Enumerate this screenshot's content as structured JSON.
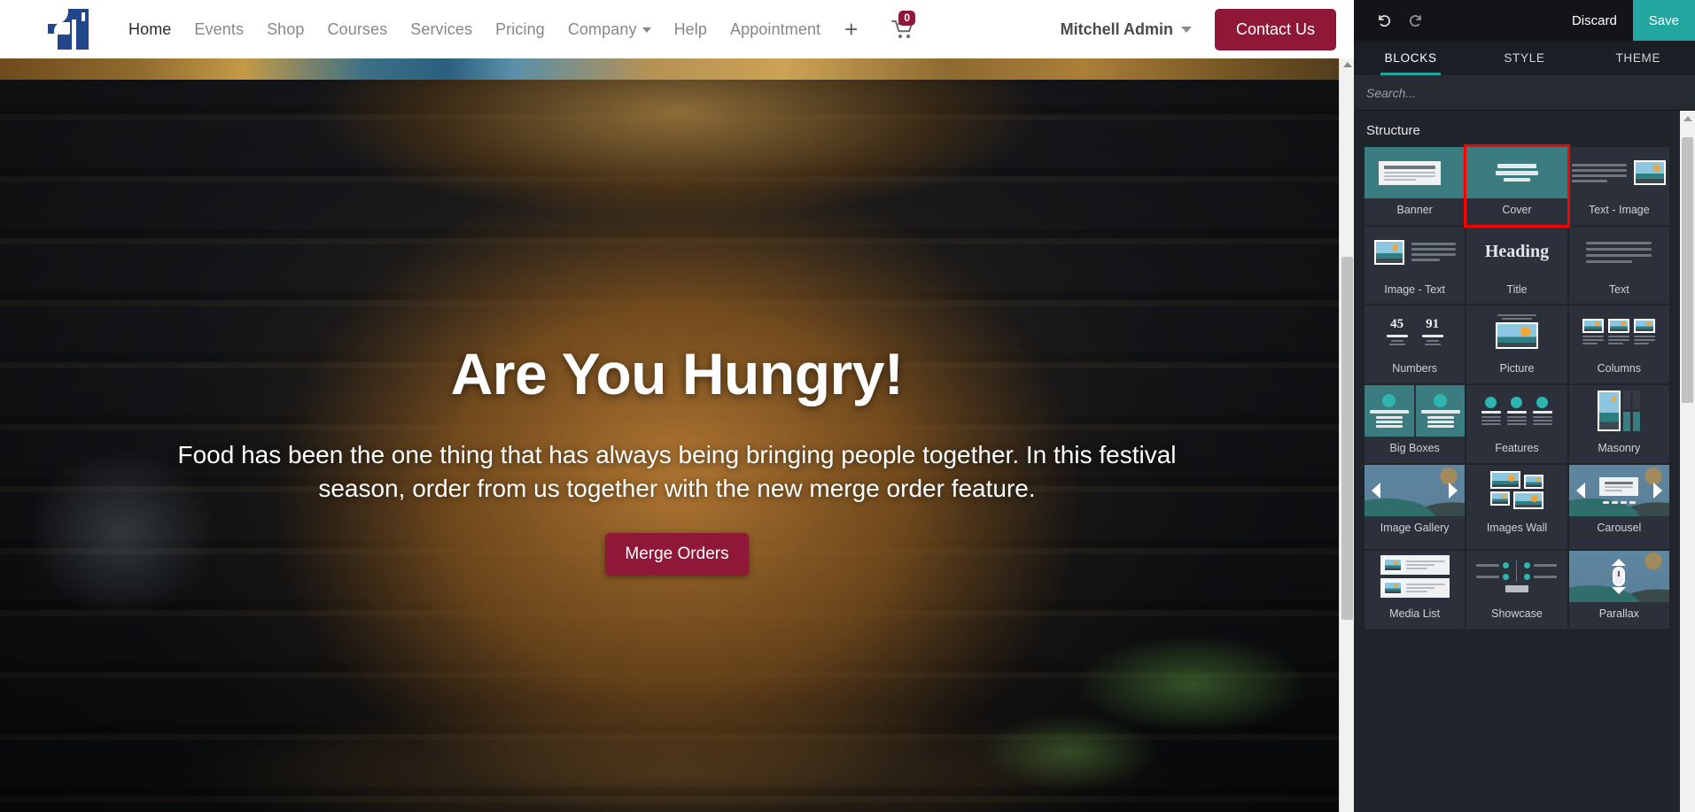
{
  "website": {
    "navbar": {
      "logo_alt": "company-logo",
      "menu": [
        {
          "label": "Home",
          "active": true,
          "has_caret": false
        },
        {
          "label": "Events",
          "active": false,
          "has_caret": false
        },
        {
          "label": "Shop",
          "active": false,
          "has_caret": false
        },
        {
          "label": "Courses",
          "active": false,
          "has_caret": false
        },
        {
          "label": "Services",
          "active": false,
          "has_caret": false
        },
        {
          "label": "Pricing",
          "active": false,
          "has_caret": false
        },
        {
          "label": "Company",
          "active": false,
          "has_caret": true
        },
        {
          "label": "Help",
          "active": false,
          "has_caret": false
        },
        {
          "label": "Appointment",
          "active": false,
          "has_caret": false
        }
      ],
      "add_label": "+",
      "cart_count": "0",
      "user_name": "Mitchell Admin",
      "contact_label": "Contact Us",
      "accent_color": "#8f1839"
    },
    "hero": {
      "title": "Are You Hungry!",
      "subtitle": "Food has been the one thing that has always being bringing people together. In this festival season, order from us together with the new merge order feature.",
      "cta_label": "Merge Orders"
    }
  },
  "editor": {
    "toolbar": {
      "undo_label": "undo",
      "redo_label": "redo",
      "discard_label": "Discard",
      "save_label": "Save",
      "save_color": "#23a5a0"
    },
    "tabs": [
      {
        "label": "BLOCKS",
        "active": true
      },
      {
        "label": "STYLE",
        "active": false
      },
      {
        "label": "THEME",
        "active": false
      }
    ],
    "search": {
      "placeholder": "Search...",
      "value": ""
    },
    "sections": [
      {
        "title": "Structure",
        "blocks": [
          {
            "label": "Banner",
            "thumb": "banner",
            "selected": false
          },
          {
            "label": "Cover",
            "thumb": "cover",
            "selected": true
          },
          {
            "label": "Text - Image",
            "thumb": "text-image",
            "selected": false
          },
          {
            "label": "Image - Text",
            "thumb": "image-text",
            "selected": false
          },
          {
            "label": "Title",
            "thumb": "title",
            "selected": false
          },
          {
            "label": "Text",
            "thumb": "text",
            "selected": false
          },
          {
            "label": "Numbers",
            "thumb": "numbers",
            "selected": false
          },
          {
            "label": "Picture",
            "thumb": "picture",
            "selected": false
          },
          {
            "label": "Columns",
            "thumb": "columns",
            "selected": false
          },
          {
            "label": "Big Boxes",
            "thumb": "big-boxes",
            "selected": false
          },
          {
            "label": "Features",
            "thumb": "features",
            "selected": false
          },
          {
            "label": "Masonry",
            "thumb": "masonry",
            "selected": false
          },
          {
            "label": "Image Gallery",
            "thumb": "image-gallery",
            "selected": false
          },
          {
            "label": "Images Wall",
            "thumb": "images-wall",
            "selected": false
          },
          {
            "label": "Carousel",
            "thumb": "carousel",
            "selected": false
          },
          {
            "label": "Media List",
            "thumb": "media-list",
            "selected": false
          },
          {
            "label": "Showcase",
            "thumb": "showcase",
            "selected": false
          },
          {
            "label": "Parallax",
            "thumb": "parallax",
            "selected": false
          }
        ]
      }
    ],
    "title_thumb_text": "Heading",
    "numbers_thumb": {
      "a": "45",
      "b": "91"
    },
    "selection_highlight_color": "#ff0000"
  }
}
